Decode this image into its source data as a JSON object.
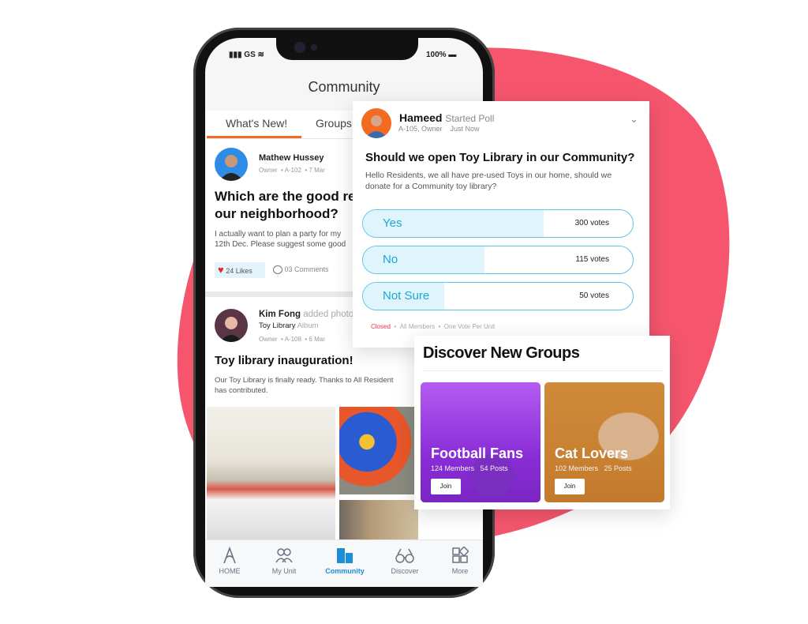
{
  "colors": {
    "blob": "#f5566e",
    "accent": "#f26b21",
    "poll": "#1aa7d8",
    "active_nav": "#1a8fd8",
    "closed": "#f0304f"
  },
  "status_bar": {
    "carrier": "GS",
    "battery": "100%"
  },
  "header": {
    "title": "Community"
  },
  "tabs": [
    {
      "label": "What's New!",
      "active": true
    },
    {
      "label": "Groups",
      "active": false
    }
  ],
  "posts": [
    {
      "author": "Mathew Hussey",
      "role": "Owner",
      "unit": "A-102",
      "date": "7 Mar",
      "headline": "Which are the good re\nour neighborhood?",
      "headline_l1": "Which are the good re",
      "headline_l2": "our neighborhood?",
      "body_l1": "I actually want to plan a party for my",
      "body_l2": "12th Dec. Please suggest some good",
      "likes": "24 Likes",
      "comments": "03 Comments"
    },
    {
      "author": "Kim Fong",
      "action": "added photos",
      "album": "Toy Library",
      "album_suffix": "Album",
      "role": "Owner",
      "unit": "A-108",
      "date": "6 Mar",
      "headline": "Toy library inauguration!",
      "body_l1": "Our Toy Library is finally ready. Thanks to All Resident",
      "body_l2": "has contributed."
    }
  ],
  "poll": {
    "author": "Hameed",
    "action": "Started Poll",
    "unit_role": "A-105, Owner",
    "time": "Just Now",
    "question": "Should we open Toy Library in our Community?",
    "description": "Hello Residents, we all have pre-used Toys in our home, should we donate for a Community toy library?",
    "options": [
      {
        "label": "Yes",
        "votes": "300 votes",
        "count": 300
      },
      {
        "label": "No",
        "votes": "115 votes",
        "count": 115
      },
      {
        "label": "Not Sure",
        "votes": "50 votes",
        "count": 50
      }
    ],
    "status": "Closed",
    "audience": "All Members",
    "rule": "One Vote Per Unit"
  },
  "discover": {
    "title": "Discover New Groups",
    "groups": [
      {
        "name": "Football Fans",
        "members": "124 Members",
        "posts": "54 Posts",
        "join": "Join"
      },
      {
        "name": "Cat Lovers",
        "members": "102 Members",
        "posts": "25 Posts",
        "join": "Join"
      }
    ]
  },
  "bottom_nav": [
    {
      "label": "HOME",
      "icon": "home-a-icon"
    },
    {
      "label": "My Unit",
      "icon": "users-icon"
    },
    {
      "label": "Community",
      "icon": "buildings-icon",
      "active": true
    },
    {
      "label": "Discover",
      "icon": "binoculars-icon"
    },
    {
      "label": "More",
      "icon": "grid-icon"
    }
  ]
}
